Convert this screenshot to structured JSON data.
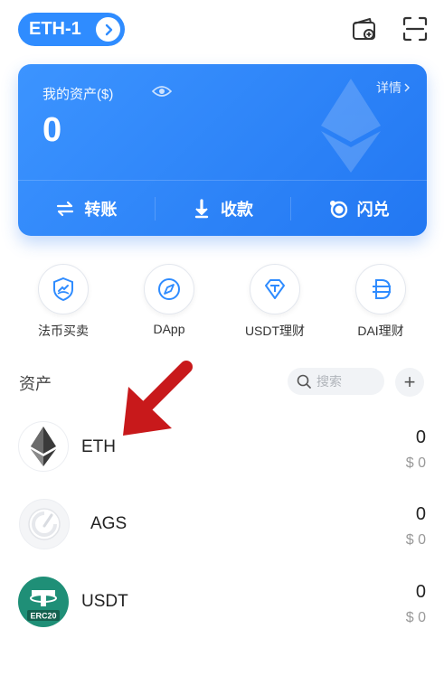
{
  "header": {
    "network_label": "ETH-1",
    "icons": [
      "chevron-right-icon",
      "add-wallet-icon",
      "scan-icon"
    ]
  },
  "asset_card": {
    "label": "我的资产($)",
    "detail_link": "详情",
    "total_value": "0",
    "actions": [
      {
        "label": "转账",
        "icon": "transfer-icon"
      },
      {
        "label": "收款",
        "icon": "receive-icon"
      },
      {
        "label": "闪兑",
        "icon": "swap-icon"
      }
    ],
    "colors": {
      "start": "#3c94ff",
      "end": "#2277f2"
    }
  },
  "features": [
    {
      "label": "法币买卖",
      "icon": "fiat-trade-icon"
    },
    {
      "label": "DApp",
      "icon": "compass-icon"
    },
    {
      "label": "USDT理财",
      "icon": "usdt-finance-icon"
    },
    {
      "label": "DAI理财",
      "icon": "dai-finance-icon"
    }
  ],
  "assets": {
    "title": "资产",
    "search_placeholder": "搜索",
    "add_label": "+",
    "tokens": [
      {
        "symbol": "ETH",
        "amount": "0",
        "fiat": "$ 0",
        "icon": "ethereum-icon"
      },
      {
        "symbol": "AGS",
        "amount": "0",
        "fiat": "$ 0",
        "icon": "ags-token-icon"
      },
      {
        "symbol": "USDT",
        "amount": "0",
        "fiat": "$ 0",
        "icon": "tether-icon",
        "badge": "ERC20"
      }
    ]
  },
  "annotation": {
    "icon": "red-arrow-icon",
    "color": "#c8191b"
  },
  "colors": {
    "accent": "#2f8cff",
    "text": "#222222",
    "muted": "#999999"
  }
}
